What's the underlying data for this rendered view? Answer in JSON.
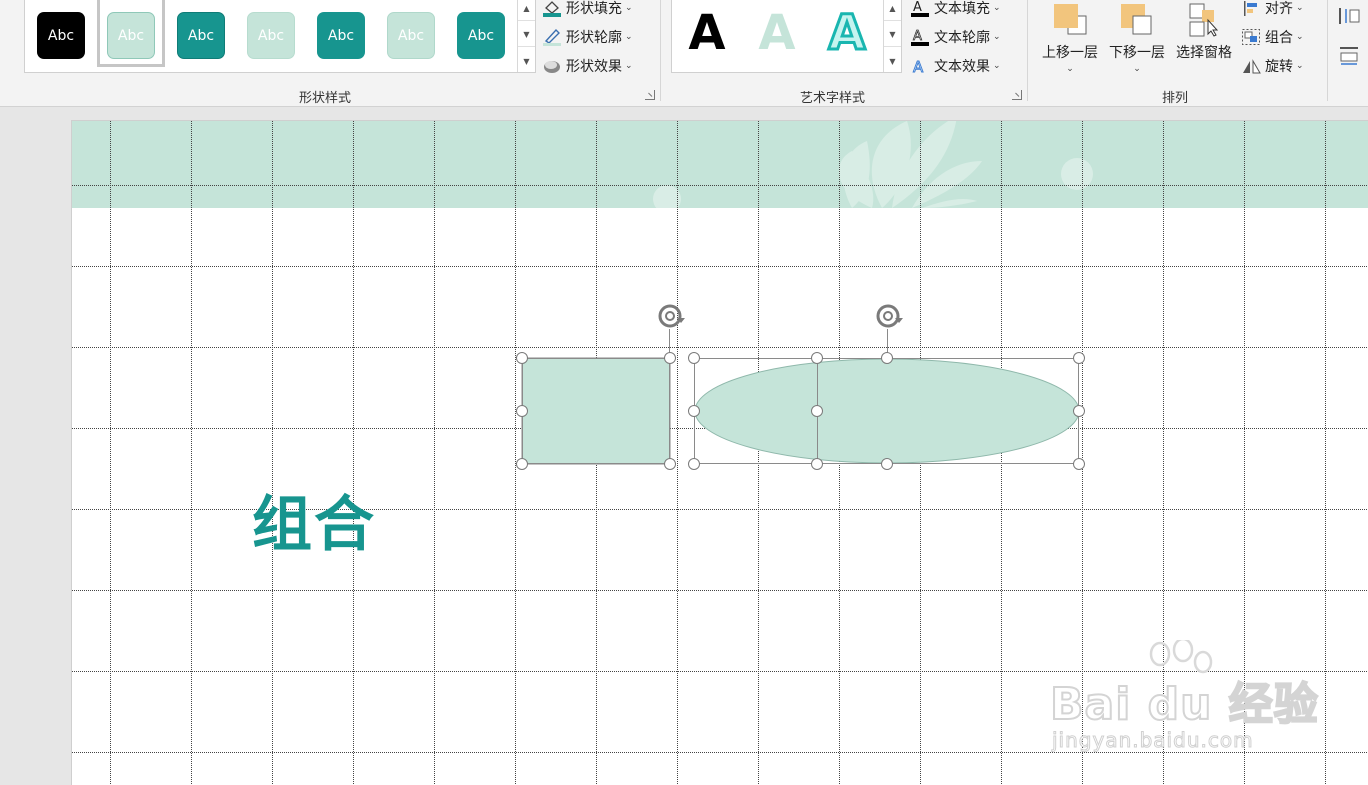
{
  "ribbon": {
    "shape_styles": {
      "group_label": "形状样式",
      "tiles": [
        {
          "text": "Abc",
          "bg": "#000000",
          "fg": "#ffffff",
          "border": "#000000"
        },
        {
          "text": "Abc",
          "bg": "#c5e4d9",
          "fg": "#ffffff",
          "border": "#8fc8b8"
        },
        {
          "text": "Abc",
          "bg": "#17958f",
          "fg": "#ffffff",
          "border": "#0f7c77"
        },
        {
          "text": "Abc",
          "bg": "#c5e4d9",
          "fg": "#ffffff",
          "border": "#c5e4d9"
        },
        {
          "text": "Abc",
          "bg": "#17958f",
          "fg": "#ffffff",
          "border": "#17958f"
        },
        {
          "text": "Abc",
          "bg": "#c5e4d9",
          "fg": "#ffffff",
          "border": "#b0d8cb"
        },
        {
          "text": "Abc",
          "bg": "#17958f",
          "fg": "#ffffff",
          "border": "#17958f"
        }
      ],
      "commands": {
        "fill": "形状填充",
        "outline": "形状轮廓",
        "effects": "形状效果"
      }
    },
    "wordart_styles": {
      "group_label": "艺术字样式",
      "letters": [
        "A",
        "A",
        "A"
      ],
      "commands": {
        "text_fill": "文本填充",
        "text_outline": "文本轮廓",
        "text_effects": "文本效果"
      }
    },
    "arrange": {
      "group_label": "排列",
      "bring_forward": "上移一层",
      "send_backward": "下移一层",
      "selection_pane": "选择窗格",
      "align": "对齐",
      "group": "组合",
      "rotate": "旋转"
    }
  },
  "slide": {
    "title": "组合",
    "accent_color": "#17958f",
    "banner_color": "#c5e4d9",
    "shape_fill": "#c5e4d9"
  },
  "watermark": {
    "brand": "Bai du 经验",
    "url": "jingyan.baidu.com"
  }
}
